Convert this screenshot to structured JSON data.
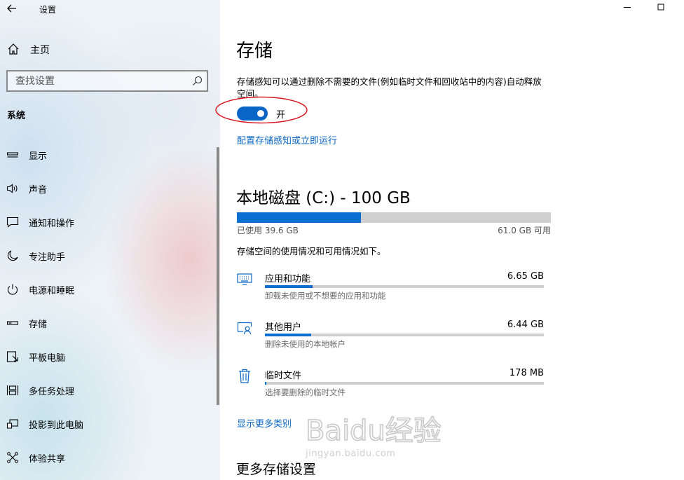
{
  "window": {
    "title": "设置"
  },
  "sidebar": {
    "home_label": "主页",
    "search_placeholder": "查找设置",
    "section_label": "系统",
    "items": [
      {
        "label": "显示",
        "icon": "monitor-icon"
      },
      {
        "label": "声音",
        "icon": "speaker-icon"
      },
      {
        "label": "通知和操作",
        "icon": "notification-icon"
      },
      {
        "label": "专注助手",
        "icon": "moon-icon"
      },
      {
        "label": "电源和睡眠",
        "icon": "power-icon"
      },
      {
        "label": "存储",
        "icon": "storage-icon"
      },
      {
        "label": "平板电脑",
        "icon": "tablet-icon"
      },
      {
        "label": "多任务处理",
        "icon": "multitask-icon"
      },
      {
        "label": "投影到此电脑",
        "icon": "project-icon"
      },
      {
        "label": "体验共享",
        "icon": "share-icon"
      }
    ]
  },
  "main": {
    "title": "存储",
    "description": "存储感知可以通过删除不需要的文件(例如临时文件和回收站中的内容)自动释放空间。",
    "toggle": {
      "state_label": "开",
      "on": true
    },
    "configure_link": "配置存储感知或立即运行",
    "drive": {
      "title": "本地磁盘 (C:) - 100 GB",
      "used_label": "已使用 39.6 GB",
      "free_label": "61.0 GB 可用",
      "used_fraction": 0.396
    },
    "usage_intro": "存储空间的使用情况和可用情况如下。",
    "categories": [
      {
        "name": "应用和功能",
        "size": "6.65 GB",
        "sub": "卸载未使用或不想要的应用和功能",
        "fraction": 0.17,
        "icon": "keyboard-icon"
      },
      {
        "name": "其他用户",
        "size": "6.44 GB",
        "sub": "删除未使用的本地帐户",
        "fraction": 0.165,
        "icon": "user-icon"
      },
      {
        "name": "临时文件",
        "size": "178 MB",
        "sub": "选择要删除的临时文件",
        "fraction": 0.005,
        "icon": "trash-icon"
      }
    ],
    "show_more_link": "显示更多类别",
    "more_settings_title": "更多存储设置"
  },
  "watermark": {
    "brand": "Baidu经验",
    "url": "jingyan.baidu.com"
  },
  "colors": {
    "accent": "#0a66c6",
    "link": "#0b66c0",
    "bar_fill": "#0a6fd1",
    "bar_track": "#cfcfcf",
    "annotation": "#d8141c"
  }
}
